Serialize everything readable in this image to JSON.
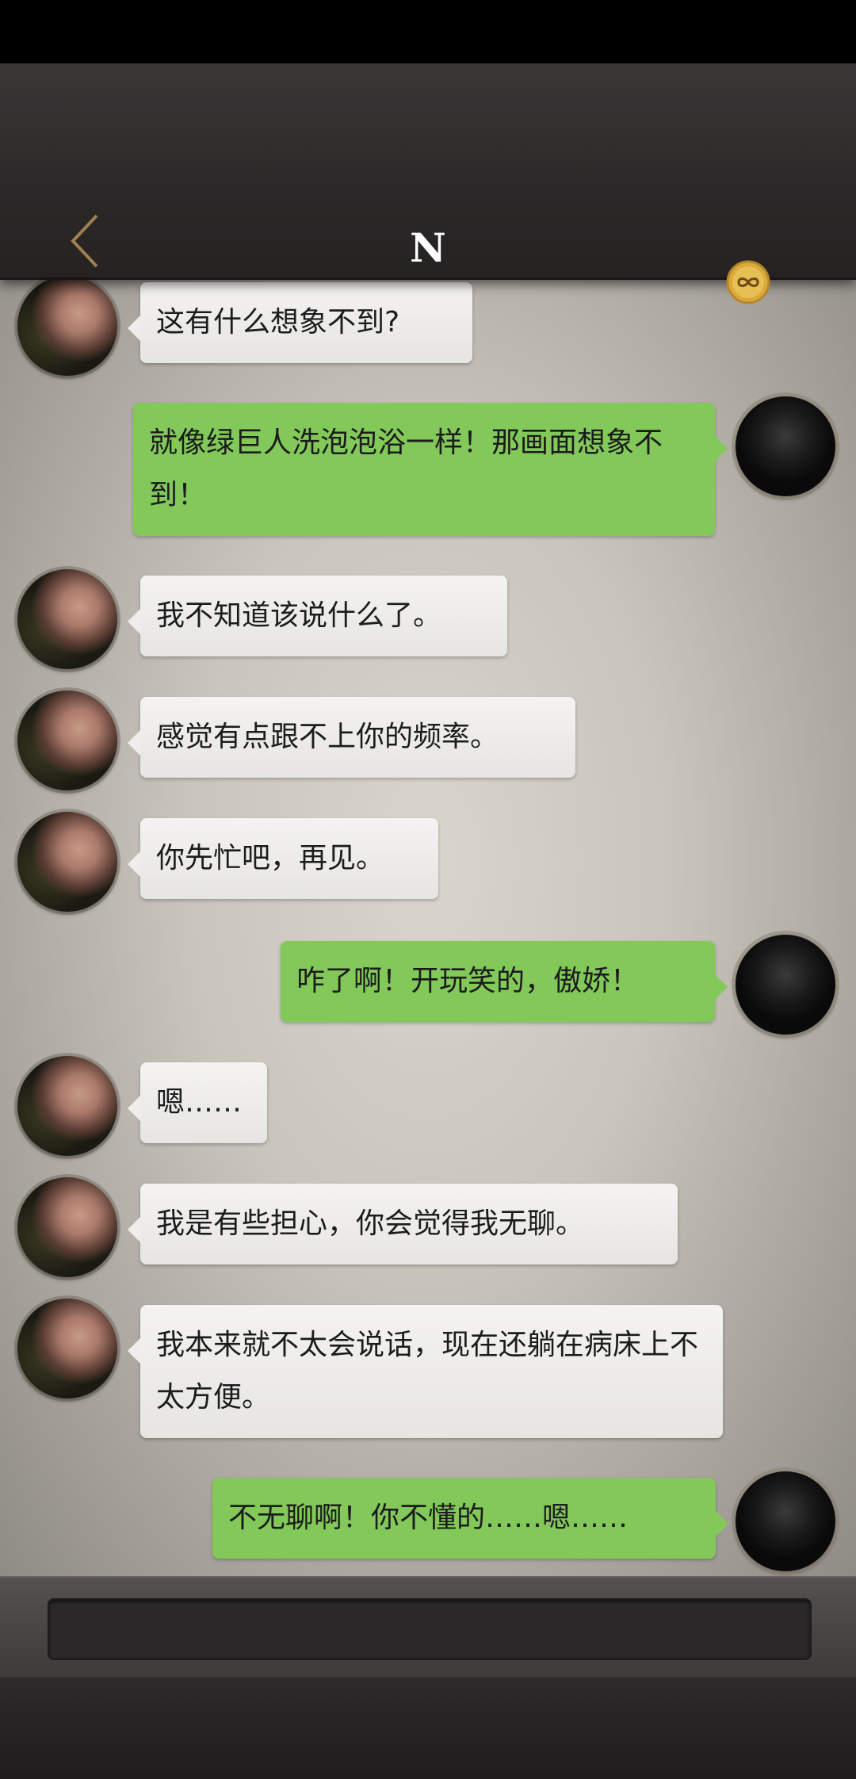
{
  "header": {
    "title": "N",
    "back_icon": "chevron-left-icon",
    "badge_icon": "infinity-badge-icon",
    "accent_color": "#a08050",
    "badge_color": "#d9a93a"
  },
  "messages": [
    {
      "from": "other",
      "text": "这有什么想象不到?"
    },
    {
      "from": "self",
      "text": "就像绿巨人洗泡泡浴一样！那画面想象不到！"
    },
    {
      "from": "other",
      "text": "我不知道该说什么了。"
    },
    {
      "from": "other",
      "text": "感觉有点跟不上你的频率。"
    },
    {
      "from": "other",
      "text": "你先忙吧，再见。"
    },
    {
      "from": "self",
      "text": "咋了啊！开玩笑的，傲娇！"
    },
    {
      "from": "other",
      "text": "嗯……"
    },
    {
      "from": "other",
      "text": "我是有些担心，你会觉得我无聊。"
    },
    {
      "from": "other",
      "text": "我本来就不太会说话，现在还躺在病床上不太方便。"
    },
    {
      "from": "self",
      "text": "不无聊啊！你不懂的……嗯……"
    }
  ],
  "colors": {
    "self_bubble": "#82c95a",
    "other_bubble": "#f0efed"
  },
  "input": {
    "placeholder": ""
  }
}
